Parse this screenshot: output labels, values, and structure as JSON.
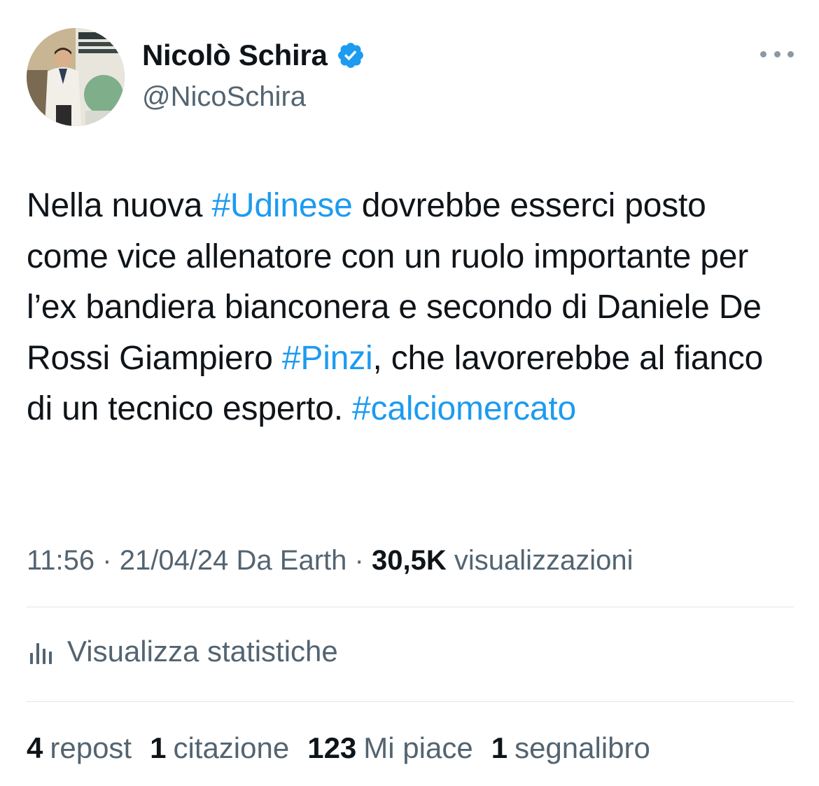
{
  "author": {
    "display_name": "Nicolò Schira",
    "handle": "@NicoSchira",
    "verified": true
  },
  "tweet": {
    "parts": [
      {
        "text": "Nella nuova ",
        "type": "text"
      },
      {
        "text": "#Udinese",
        "type": "hashtag"
      },
      {
        "text": " dovrebbe esserci posto come vice allenatore con un ruolo importante per l’ex bandiera bianconera e secondo di Daniele De Rossi Giampiero ",
        "type": "text"
      },
      {
        "text": "#Pinzi",
        "type": "hashtag"
      },
      {
        "text": ", che lavorerebbe al fianco di un tecnico esperto. ",
        "type": "text"
      },
      {
        "text": "#calciomercato",
        "type": "hashtag"
      }
    ]
  },
  "meta": {
    "time": "11:56",
    "date": "21/04/24",
    "source": "Da Earth",
    "views_count": "30,5K",
    "views_label": "visualizzazioni"
  },
  "stats_link": {
    "label": "Visualizza statistiche"
  },
  "engagement": {
    "reposts": {
      "count": "4",
      "label": "repost"
    },
    "quotes": {
      "count": "1",
      "label": "citazione"
    },
    "likes": {
      "count": "123",
      "label": "Mi piace"
    },
    "bookmarks": {
      "count": "1",
      "label": "segnalibro"
    }
  },
  "colors": {
    "accent": "#1d9bf0",
    "text_primary": "#0f1419",
    "text_secondary": "#536471",
    "divider": "#e1e6ea",
    "verified_badge": "#1d9bf0"
  },
  "icons": {
    "verified": "verified-badge-icon",
    "more": "more-icon",
    "stats": "bar-chart-icon"
  }
}
